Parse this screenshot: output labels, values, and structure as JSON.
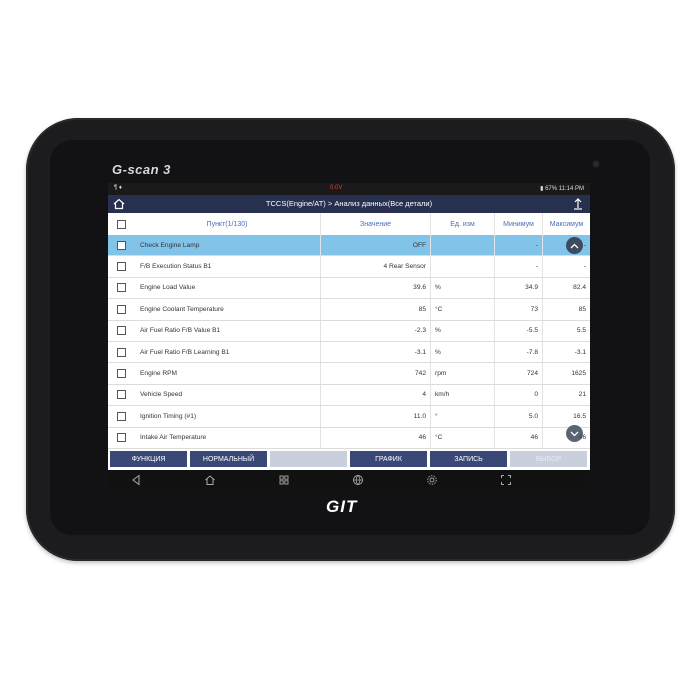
{
  "device": {
    "brand": "G-scan 3",
    "logo": "GIT"
  },
  "statusbar": {
    "left": "¶ ♦",
    "center": "0.0V",
    "right": "▮ 67%  11:14 PM"
  },
  "navbar": {
    "title": "TCCS(Engine/AT) > Анализ данных(Все детали)"
  },
  "table": {
    "headers": {
      "item": "Пункт(1/130)",
      "value": "Значение",
      "unit": "Ед. изм",
      "min": "Минимум",
      "max": "Максимум"
    },
    "rows": [
      {
        "name": "Check Engine Lamp",
        "value": "OFF",
        "unit": "",
        "min": "-",
        "max": "-"
      },
      {
        "name": "F/B Execution Status B1",
        "value": "4 Rear Sensor",
        "unit": "",
        "min": "-",
        "max": "-"
      },
      {
        "name": "Engine Load Value",
        "value": "39.6",
        "unit": "%",
        "min": "34.9",
        "max": "82.4"
      },
      {
        "name": "Engine Coolant Temperature",
        "value": "85",
        "unit": "°C",
        "min": "73",
        "max": "85"
      },
      {
        "name": "Air Fuel Ratio F/B Value B1",
        "value": "-2.3",
        "unit": "%",
        "min": "-5.5",
        "max": "5.5"
      },
      {
        "name": "Air Fuel Ratio F/B Learning B1",
        "value": "-3.1",
        "unit": "%",
        "min": "-7.8",
        "max": "-3.1"
      },
      {
        "name": "Engine RPM",
        "value": "742",
        "unit": "rpm",
        "min": "724",
        "max": "1625"
      },
      {
        "name": "Vehicle Speed",
        "value": "4",
        "unit": "km/h",
        "min": "0",
        "max": "21"
      },
      {
        "name": "Ignition Timing (#1)",
        "value": "11.0",
        "unit": "°",
        "min": "5.0",
        "max": "16.5"
      },
      {
        "name": "Intake Air Temperature",
        "value": "46",
        "unit": "°C",
        "min": "46",
        "max": "46"
      }
    ]
  },
  "buttons": {
    "function": "ФУНКЦИЯ",
    "normal": "НОРМАЛЬНЫЙ",
    "blank": "",
    "graph": "ГРАФИК",
    "record": "ЗАПИСЬ",
    "select": "ВЫБОР"
  },
  "colors": {
    "navbar": "#27304f",
    "selected_row": "#82c3ea",
    "button": "#3a4877",
    "header_text": "#4b6fb4"
  }
}
